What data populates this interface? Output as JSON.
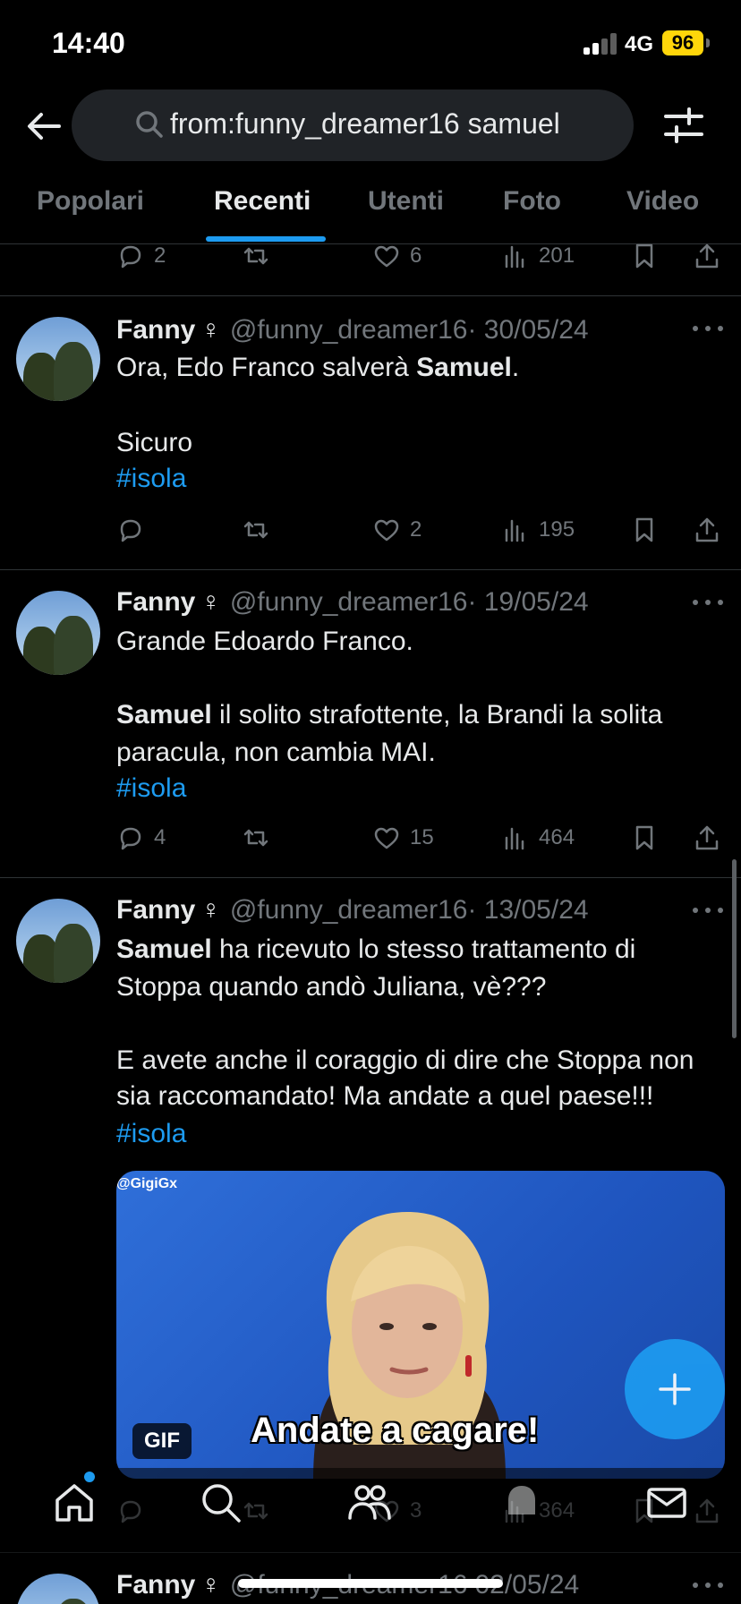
{
  "status_bar": {
    "time": "14:40",
    "network": "4G",
    "battery": "96",
    "battery_color": "#ffd60a"
  },
  "header": {
    "back_icon": "arrow-left-icon",
    "search_query": "from:funny_dreamer16 samuel",
    "filter_icon": "sliders-icon"
  },
  "tabs": [
    {
      "label": "Popolari",
      "active": false
    },
    {
      "label": "Recenti",
      "active": true
    },
    {
      "label": "Utenti",
      "active": false
    },
    {
      "label": "Foto",
      "active": false
    },
    {
      "label": "Video",
      "active": false
    }
  ],
  "accent_color": "#1d9bf0",
  "partial_tweet_top": {
    "replies": "2",
    "retweets": "",
    "likes": "6",
    "views": "201"
  },
  "tweets": [
    {
      "name": "Fanny",
      "gender": "♀",
      "handle": "@funny_dreamer16",
      "date": "· 30/05/24",
      "lines": [
        {
          "pre": "Ora, Edo Franco salverà ",
          "bold": "Samuel",
          "post": "."
        },
        {
          "pre": "Sicuro"
        },
        {
          "hashtag": "#isola"
        }
      ],
      "replies": "",
      "retweets": "",
      "likes": "2",
      "views": "195"
    },
    {
      "name": "Fanny",
      "gender": "♀",
      "handle": "@funny_dreamer16",
      "date": "· 19/05/24",
      "lines": [
        {
          "pre": "Grande Edoardo Franco."
        },
        {
          "bold": "Samuel",
          "post": " il solito strafottente, la Brandi la solita"
        },
        {
          "pre": "paracula, non cambia MAI."
        },
        {
          "hashtag": "#isola"
        }
      ],
      "replies": "4",
      "retweets": "",
      "likes": "15",
      "views": "464"
    },
    {
      "name": "Fanny",
      "gender": "♀",
      "handle": "@funny_dreamer16",
      "date": "· 13/05/24",
      "lines": [
        {
          "bold": "Samuel",
          "post": " ha ricevuto lo stesso trattamento di"
        },
        {
          "pre": "Stoppa quando andò Juliana, vè???"
        },
        {
          "pre": "E avete anche il coraggio di dire che Stoppa non"
        },
        {
          "pre": "sia raccomandato! Ma andate a quel paese!!!"
        },
        {
          "hashtag": "#isola"
        }
      ],
      "media": {
        "badge": "GIF",
        "caption": "Andate a cagare!",
        "watermark": "@GigiGx"
      },
      "replies": "",
      "retweets": "",
      "likes": "3",
      "views": "364"
    },
    {
      "name": "Fanny",
      "gender": "♀",
      "handle": "@funny_dreamer16",
      "date": "02/05/24"
    }
  ],
  "bottom_nav": [
    "home-icon",
    "search-icon",
    "communities-icon",
    "notifications-icon",
    "messages-icon"
  ],
  "fab_icon": "plus-icon"
}
